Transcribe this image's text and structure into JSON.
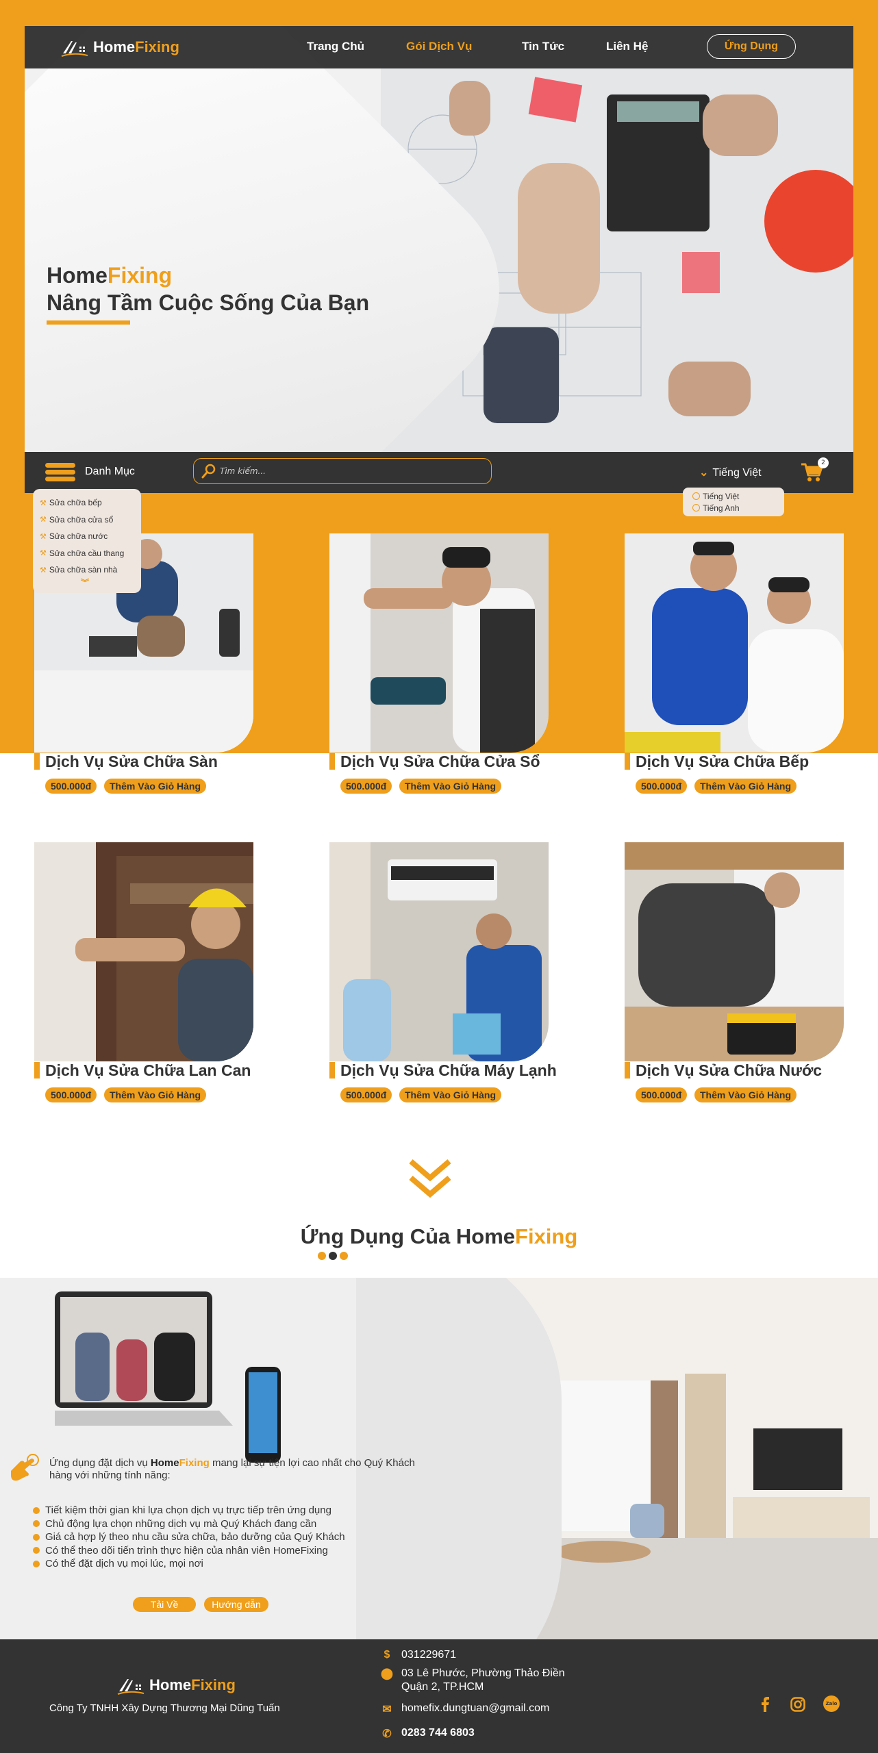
{
  "colors": {
    "accent": "#ef9f1b",
    "dark": "#333333"
  },
  "brand": {
    "name_a": "Home",
    "name_b": "Fixing"
  },
  "nav": {
    "items": [
      {
        "label": "Trang Chủ"
      },
      {
        "label": "Gói Dịch Vụ"
      },
      {
        "label": "Tin Tức"
      },
      {
        "label": "Liên Hệ"
      }
    ],
    "app_button": "Ứng Dụng"
  },
  "hero": {
    "title_a": "Home",
    "title_b": "Fixing",
    "subtitle": "Nâng Tầm Cuộc Sống Của Bạn"
  },
  "toolbar": {
    "menu_label": "Danh Mục",
    "search_placeholder": "Tìm kiếm...",
    "language": "Tiếng Việt",
    "cart_count": "2"
  },
  "category_menu": {
    "items": [
      {
        "label": "Sửa chữa bếp"
      },
      {
        "label": "Sửa chữa cửa sổ"
      },
      {
        "label": "Sửa chữa nước"
      },
      {
        "label": "Sửa chữa cầu thang"
      },
      {
        "label": "Sửa chữa sàn nhà"
      }
    ]
  },
  "language_menu": {
    "items": [
      {
        "label": "Tiếng Việt"
      },
      {
        "label": "Tiếng Anh"
      }
    ]
  },
  "services": [
    {
      "title": "Dịch Vụ Sửa Chữa Sàn",
      "price": "500.000đ",
      "add_label": "Thêm Vào Giỏ Hàng"
    },
    {
      "title": "Dịch Vụ Sửa Chữa Cửa Sổ",
      "price": "500.000đ",
      "add_label": "Thêm Vào Giỏ Hàng"
    },
    {
      "title": "Dịch Vụ Sửa Chữa Bếp",
      "price": "500.000đ",
      "add_label": "Thêm Vào Giỏ Hàng"
    },
    {
      "title": "Dịch Vụ Sửa Chữa Lan Can",
      "price": "500.000đ",
      "add_label": "Thêm Vào Giỏ Hàng"
    },
    {
      "title": "Dịch Vụ Sửa Chữa Máy Lạnh",
      "price": "500.000đ",
      "add_label": "Thêm Vào Giỏ Hàng"
    },
    {
      "title": "Dịch Vụ Sửa Chữa Nước",
      "price": "500.000đ",
      "add_label": "Thêm Vào Giỏ Hàng"
    }
  ],
  "app_section": {
    "title_a": "Ứng Dụng Của Home",
    "title_b": "Fixing",
    "intro_a": "Ứng dụng đặt dịch vụ ",
    "intro_brand_a": "Home",
    "intro_brand_b": "Fixing",
    "intro_b": " mang lại sự tiện lợi cao nhất cho Quý Khách hàng với những tính năng:",
    "features": [
      "Tiết kiệm thời gian khi lựa chọn dịch vụ trực tiếp trên ứng dụng",
      "Chủ động lựa chọn những dịch vụ mà Quý Khách đang cần",
      "Giá cả hợp lý theo nhu cầu sửa chữa, bảo dưỡng của Quý Khách",
      "Có thể theo dõi tiến trình thực hiện của nhân viên HomeFixing",
      "Có thể đặt dịch vụ mọi lúc, mọi nơi"
    ],
    "download_label": "Tải Về",
    "guide_label": "Hướng dẫn"
  },
  "footer": {
    "company": "Công Ty TNHH Xây Dựng Thương Mại Dũng Tuấn",
    "phone": "031229671",
    "address_1": "03 Lê Phước, Phường Thảo Điền",
    "address_2": "Quận 2, TP.HCM",
    "email": "homefix.dungtuan@gmail.com",
    "hotline": "0283 744 6803",
    "social": [
      "facebook-icon",
      "instagram-icon",
      "zalo-icon"
    ],
    "zalo_label": "Zalo"
  }
}
